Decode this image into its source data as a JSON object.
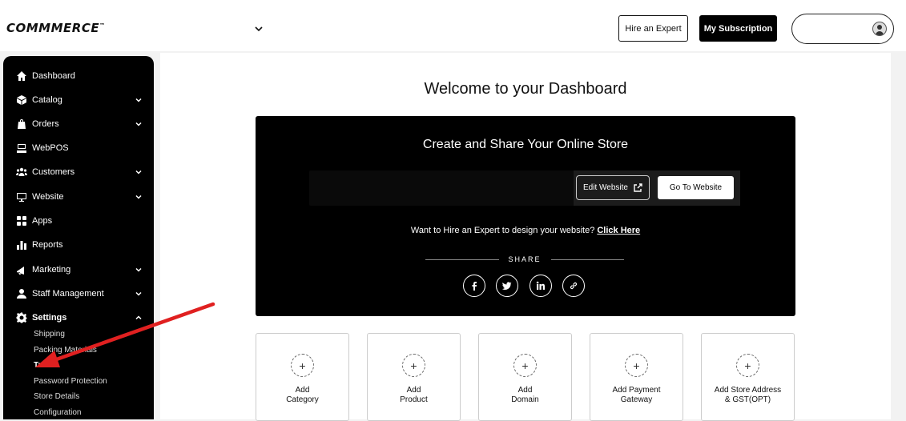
{
  "header": {
    "logo": "COMMMERCE",
    "logo_mark": "™",
    "hire_expert_label": "Hire an Expert",
    "subscription_label": "My Subscription"
  },
  "sidebar": {
    "items": [
      {
        "label": "Dashboard",
        "icon": "home-icon"
      },
      {
        "label": "Catalog",
        "icon": "catalog-icon"
      },
      {
        "label": "Orders",
        "icon": "orders-icon"
      },
      {
        "label": "WebPOS",
        "icon": "pos-icon"
      },
      {
        "label": "Customers",
        "icon": "customers-icon"
      },
      {
        "label": "Website",
        "icon": "website-icon"
      },
      {
        "label": "Apps",
        "icon": "apps-icon"
      },
      {
        "label": "Reports",
        "icon": "reports-icon"
      },
      {
        "label": "Marketing",
        "icon": "marketing-icon"
      },
      {
        "label": "Staff Management",
        "icon": "staff-icon"
      },
      {
        "label": "Settings",
        "icon": "gear-icon"
      }
    ],
    "settings_sub": [
      "Shipping",
      "Packing Materials",
      "Tax",
      "Password Protection",
      "Store Details",
      "Configuration"
    ]
  },
  "main": {
    "title": "Welcome to your Dashboard",
    "hero": {
      "title": "Create and Share Your Online Store",
      "edit_label": "Edit Website",
      "goto_label": "Go To Website",
      "hire_text": "Want to Hire an Expert to design your website?",
      "hire_link": "Click Here",
      "share_label": "SHARE"
    },
    "cards": [
      {
        "label": "Add\nCategory"
      },
      {
        "label": "Add\nProduct"
      },
      {
        "label": "Add\nDomain"
      },
      {
        "label": "Add Payment\nGateway"
      },
      {
        "label": "Add Store Address\n& GST(OPT)"
      }
    ]
  },
  "colors": {
    "annotation_arrow": "#e02020",
    "sidebar_bg": "#000000"
  }
}
